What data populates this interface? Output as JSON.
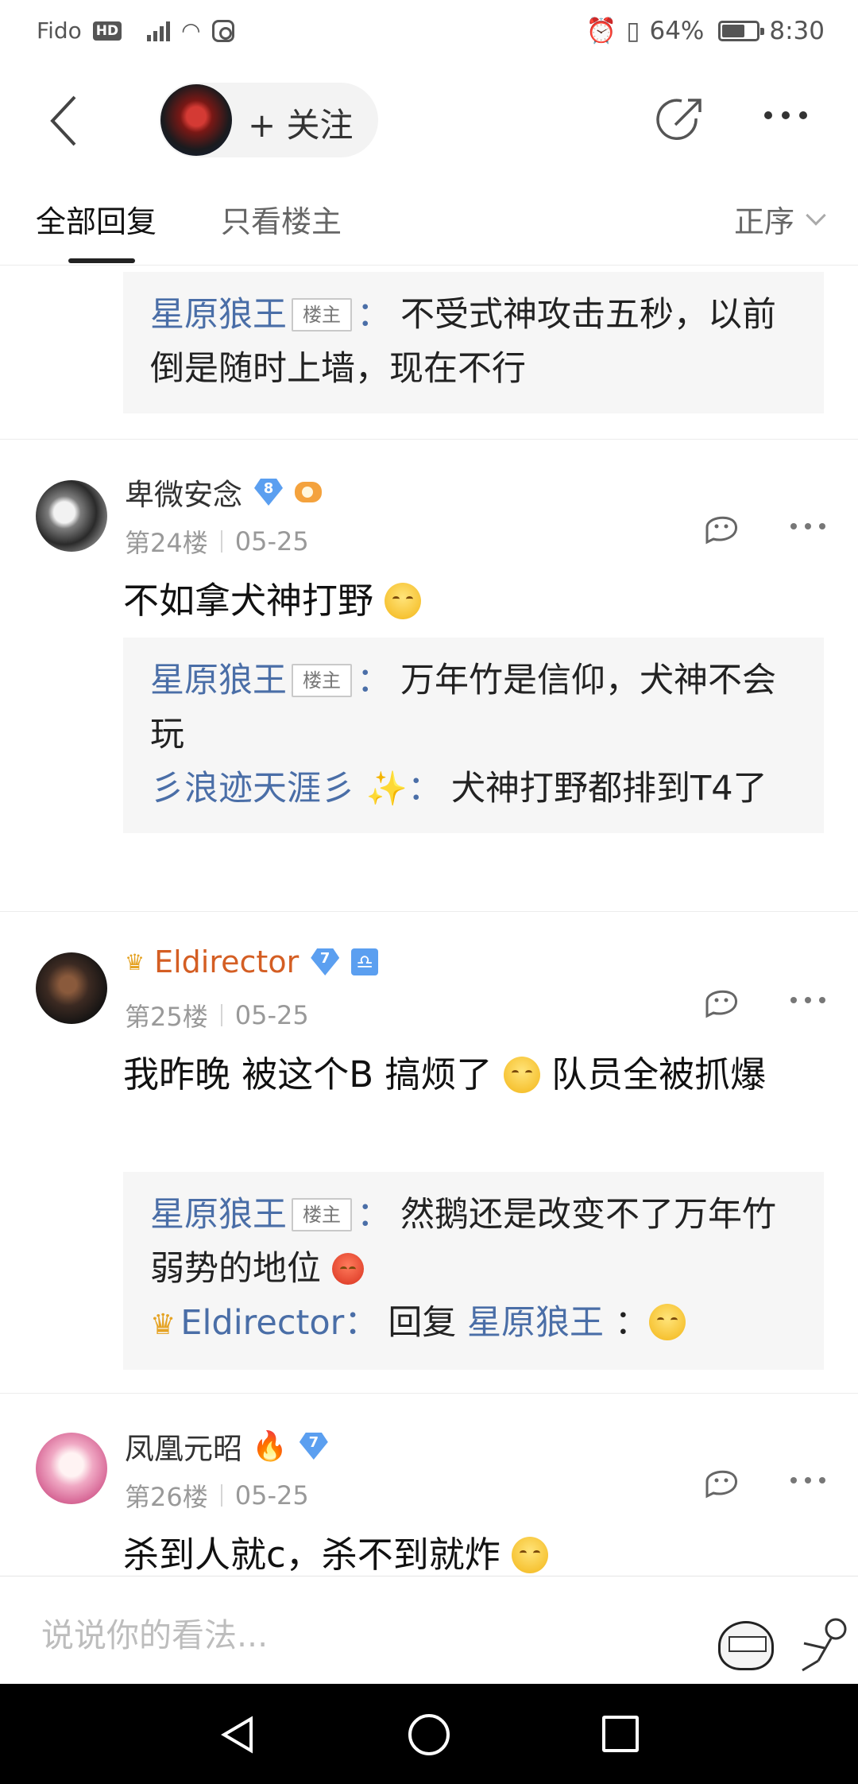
{
  "status_bar": {
    "carrier": "Fido",
    "hd": "HD",
    "battery_percent": "64%",
    "battery_level": 0.64,
    "time": "8:30"
  },
  "header": {
    "follow_label": "+ 关注"
  },
  "tabs": {
    "all_replies": "全部回复",
    "owner_only": "只看楼主",
    "sort_label": "正序"
  },
  "top_quote": {
    "author": "星原狼王",
    "badge": "楼主",
    "colon": "：",
    "text": "不受式神攻击五秒，以前倒是随时上墙，现在不行"
  },
  "posts": [
    {
      "username": "卑微安念",
      "level": "8",
      "floor": "第24楼",
      "date": "05-25",
      "content": "不如拿犬神打野",
      "replies": [
        {
          "author": "星原狼王",
          "badge": "楼主",
          "colon": "：",
          "text": "万年竹是信仰，犬神不会玩"
        },
        {
          "author": "彡浪迹天涯彡",
          "colon": "：",
          "text": "犬神打野都排到T4了"
        }
      ]
    },
    {
      "username": "Eldirector",
      "level": "7",
      "floor": "第25楼",
      "date": "05-25",
      "content": "我昨晚 被这个B 搞烦了",
      "content_tail": " 队员全被抓爆",
      "replies": [
        {
          "author": "星原狼王",
          "badge": "楼主",
          "colon": "：",
          "text": "然鹅还是改变不了万年竹弱势的地位"
        },
        {
          "author": "Eldirector",
          "colon": "：",
          "reply_word": "回复",
          "target": "星原狼王",
          "tail": "："
        }
      ]
    },
    {
      "username": "凤凰元昭",
      "level": "7",
      "floor": "第26楼",
      "date": "05-25",
      "content": "杀到人就c，杀不到就炸"
    }
  ],
  "input": {
    "placeholder": "说说你的看法..."
  },
  "colors": {
    "link_blue": "#4a6ea7",
    "vip_orange": "#d45e23",
    "level_badge_blue": "#5b9ff0"
  }
}
